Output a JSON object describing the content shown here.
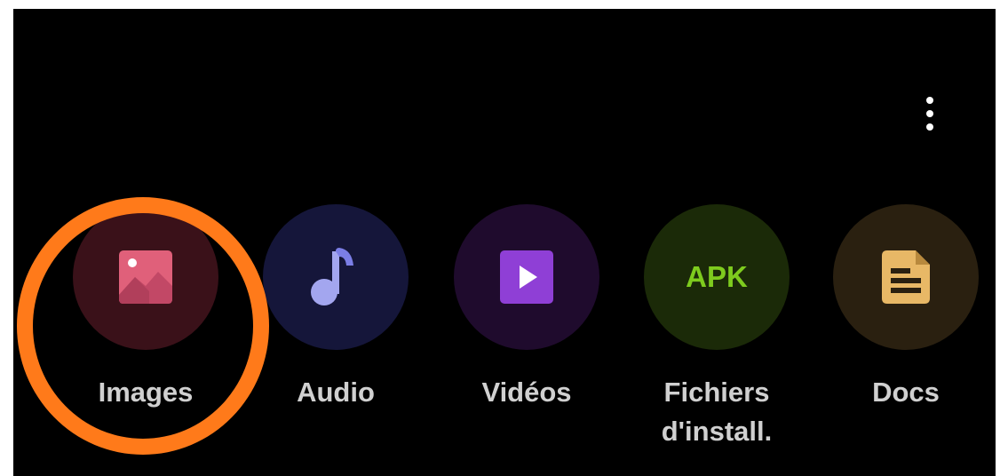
{
  "categories": [
    {
      "label": "Images",
      "icon": "image-icon",
      "bg": "#3a1119",
      "fg": "#e0607a"
    },
    {
      "label": "Audio",
      "icon": "music-note-icon",
      "bg": "#15163a",
      "fg": "#a3a6ef"
    },
    {
      "label": "Vidéos",
      "icon": "video-play-icon",
      "bg": "#1f0b2d",
      "fg": "#8f3fd6"
    },
    {
      "label_line1": "Fichiers",
      "label_line2": "d'install.",
      "icon_text": "APK",
      "icon": "apk-icon",
      "bg": "#1b2a08",
      "fg": "#7ecb1e"
    },
    {
      "label": "Docs",
      "icon": "document-icon",
      "bg": "#2a2010",
      "fg": "#e8b866"
    }
  ],
  "menu": {
    "icon": "more-vert-icon"
  },
  "highlight": {
    "color": "#ff7a1a",
    "target": "Images"
  }
}
